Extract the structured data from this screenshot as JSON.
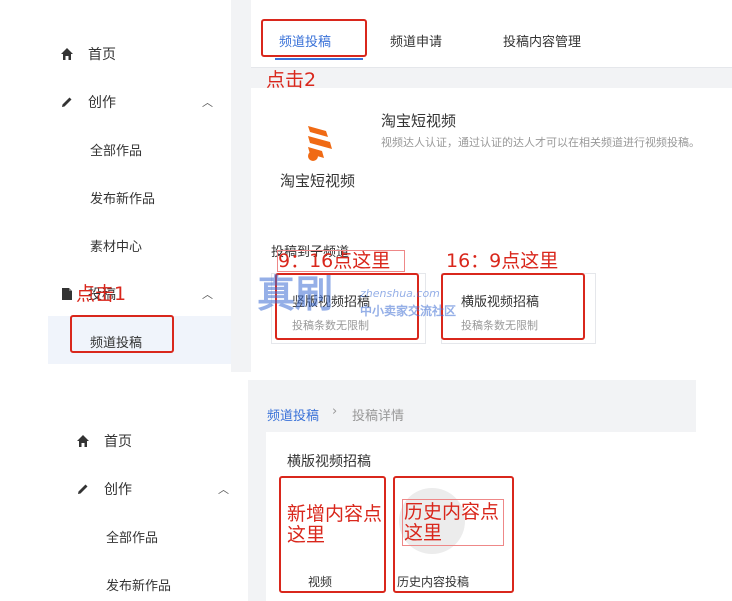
{
  "top": {
    "sidebar": {
      "home_label": "首页",
      "create_label": "创作",
      "all_works_label": "全部作品",
      "publish_new_label": "发布新作品",
      "material_center_label": "素材中心",
      "submission_label": "投稿",
      "channel_submission_label": "频道投稿"
    },
    "tabs": [
      "频道投稿",
      "频道申请",
      "投稿内容管理"
    ],
    "channel": {
      "name": "淘宝短视频",
      "description": "视频达人认证，通过认证的达人才可以在相关频道进行视频投稿。",
      "logo_text": "淘宝短视频"
    },
    "section_title": "投稿到子频道",
    "options": [
      {
        "title": "竖版视频招稿",
        "subtitle": "投稿条数无限制"
      },
      {
        "title": "横版视频招稿",
        "subtitle": "投稿条数无限制"
      }
    ],
    "annotations": {
      "click1": "点击1",
      "click2": "点击2",
      "vertical_hint": "9：16点这里",
      "horizontal_hint": "16：9点这里"
    },
    "watermark": {
      "brand": "真刷",
      "url": "zhenshua.com",
      "slogan": "中小卖家交流社区"
    }
  },
  "bottom": {
    "sidebar": {
      "home_label": "首页",
      "create_label": "创作",
      "all_works_label": "全部作品",
      "publish_new_label": "发布新作品"
    },
    "breadcrumb": {
      "parent": "频道投稿",
      "separator": "›",
      "current": "投稿详情"
    },
    "section_title": "横版视频招稿",
    "actions": [
      {
        "label": "视频",
        "hint": "新增内容点这里"
      },
      {
        "label": "历史内容投稿",
        "hint": "历史内容点这里"
      }
    ]
  },
  "colors": {
    "accent": "#3a72d8",
    "annotation": "#d9271c",
    "logo_orange": "#f06a14"
  }
}
